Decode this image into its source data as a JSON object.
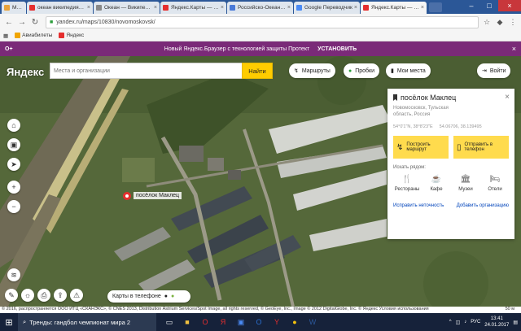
{
  "tabs": [
    {
      "title": "Меню",
      "color": "#e8a33b"
    },
    {
      "title": "океан википедия — Янд",
      "color": "#e52e2e"
    },
    {
      "title": "Океан — Википедия",
      "color": "#888888"
    },
    {
      "title": "Яндекс.Карты — подро",
      "color": "#e52e2e"
    },
    {
      "title": "Российско-Океанский д",
      "color": "#4a7ad8"
    },
    {
      "title": "Google Переводчик",
      "color": "#4a8af4"
    },
    {
      "title": "Яндекс.Карты — подро",
      "color": "#e52e2e",
      "active": true
    }
  ],
  "address": {
    "url": "yandex.ru/maps/10830/novomoskovsk/"
  },
  "bookmarks": [
    {
      "label": "Авиабилеты",
      "color": "#f0a500"
    },
    {
      "label": "Яндекс",
      "color": "#e52e2e"
    }
  ],
  "promo": {
    "left": "О+",
    "text": "Новый Яндекс.Браузер с технологией защиты Протект",
    "install": "УСТАНОВИТЬ",
    "close": "×"
  },
  "header": {
    "logo": "Яндекс",
    "search_placeholder": "Места и организации",
    "search_button": "Найти",
    "routes": "Маршруты",
    "traffic": "Пробки",
    "my_places": "Мои места",
    "login": "Войти"
  },
  "map": {
    "pin_label": "посёлок Маклец",
    "phone_promo": "Карты в телефоне",
    "copyright": "© 2016, распространяется ООО ИТЦ «СКАНЭКС», © CNES 2013, Distribution Astrium Services/Spot Image, all rights reserved, © GeoEye, Inc., Image © 2012 DigitalGlobe, Inc. © Яндекс Условия использования",
    "scale": "50 м"
  },
  "panel": {
    "title": "посёлок Маклец",
    "close": "×",
    "subtitle": "Новомосковск, Тульская область, Россия",
    "coord1": "54°0'1\"N, 38°8'23\"E",
    "coord2": "54.06706, 38.139495",
    "route_button": "Построить маршрут",
    "send_button": "Отправить в телефон",
    "nearby_label": "Искать рядом:",
    "categories": [
      {
        "label": "Рестораны",
        "icon": "🍴"
      },
      {
        "label": "Кафе",
        "icon": "☕"
      },
      {
        "label": "Музеи",
        "icon": "🏛"
      },
      {
        "label": "Отели",
        "icon": "🛏"
      }
    ],
    "link_fix": "Исправить неточность",
    "link_add": "Добавить организацию"
  },
  "taskbar": {
    "search_text": "Тренды: гандбол чемпионат мира 2",
    "time": "13:41",
    "date": "24.01.2017",
    "lang": "РУС"
  }
}
